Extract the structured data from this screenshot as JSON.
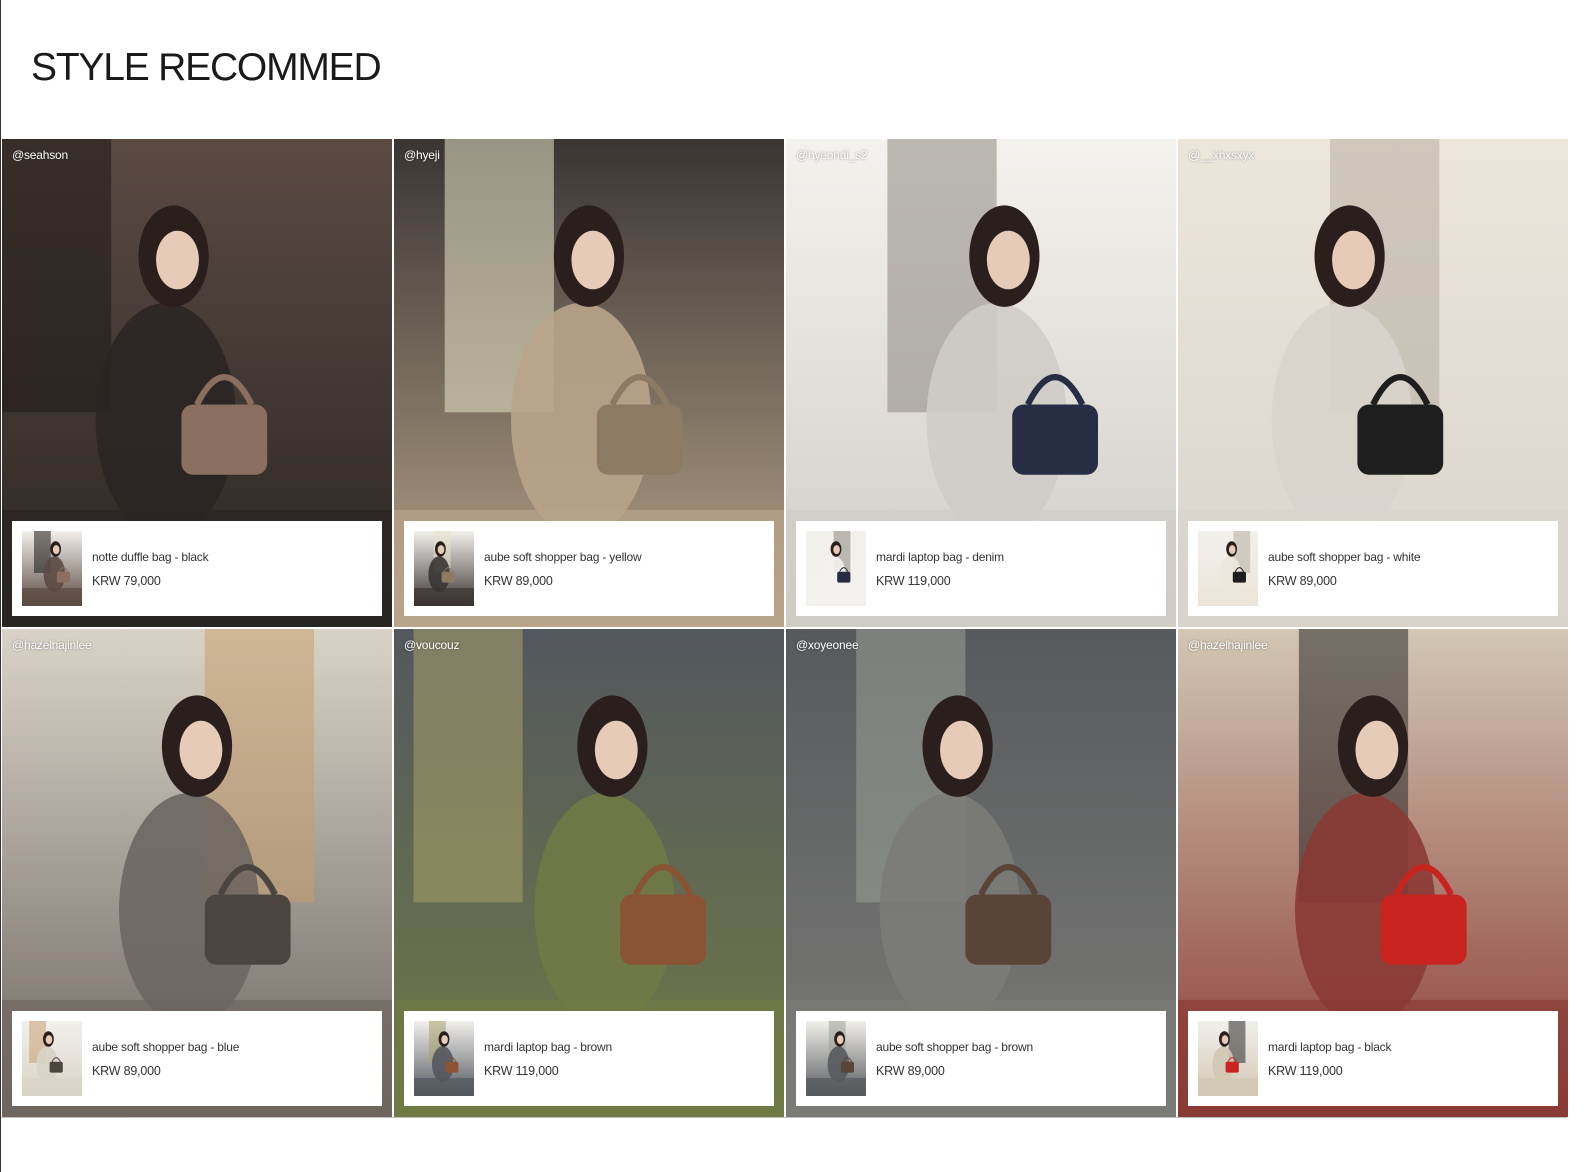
{
  "section": {
    "title": "STYLE RECOMMED"
  },
  "posts": [
    {
      "handle": "@seahson",
      "product": "notte duffle bag - black",
      "price": "KRW 79,000"
    },
    {
      "handle": "@hyeji",
      "product": "aube soft shopper bag - yellow",
      "price": "KRW 89,000"
    },
    {
      "handle": "@hyeondi_s2",
      "product": "mardi laptop bag - denim",
      "price": "KRW 119,000"
    },
    {
      "handle": "@__xhxsxyx",
      "product": "aube soft shopper bag - white",
      "price": "KRW 89,000"
    },
    {
      "handle": "@hazelhajinlee",
      "product": "aube soft shopper bag - blue",
      "price": "KRW 89,000"
    },
    {
      "handle": "@voucouz",
      "product": "mardi laptop bag - brown",
      "price": "KRW 119,000"
    },
    {
      "handle": "@xoyeonee",
      "product": "aube soft shopper bag - brown",
      "price": "KRW 89,000"
    },
    {
      "handle": "@hazelhajinlee",
      "product": "mardi laptop bag - black",
      "price": "KRW 119,000"
    }
  ],
  "colors": {
    "photo_palettes": [
      [
        "#2a2523",
        "#5b4a42",
        "#8a6e60",
        "#1b1715"
      ],
      [
        "#b9a48a",
        "#3a3533",
        "#8c7a63",
        "#e8e4c9"
      ],
      [
        "#cfccc6",
        "#f4f2ee",
        "#272d44",
        "#8c8780"
      ],
      [
        "#d8d4cc",
        "#ece6da",
        "#1e1e1e",
        "#b7ada0"
      ],
      [
        "#6e6660",
        "#d9d3c7",
        "#4b4540",
        "#c69e70"
      ],
      [
        "#6f7a45",
        "#53575e",
        "#8a5333",
        "#a7a06a"
      ],
      [
        "#7b7b77",
        "#575a5d",
        "#5a4337",
        "#9aa097"
      ],
      [
        "#8a3a34",
        "#d2c7b3",
        "#c8231f",
        "#2a2a2a"
      ]
    ]
  }
}
